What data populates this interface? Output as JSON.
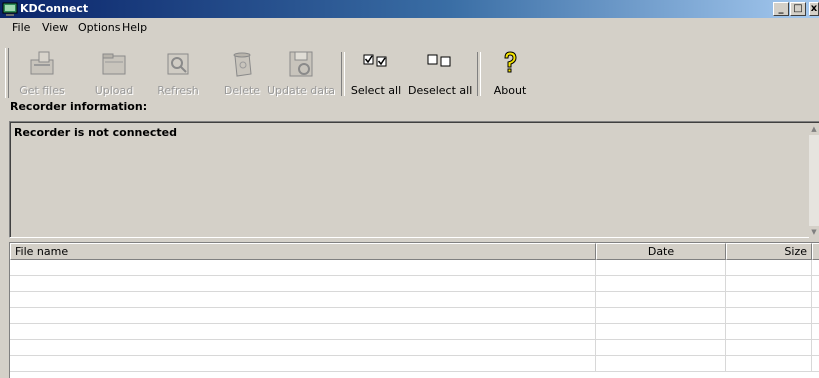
{
  "window": {
    "title": "KDConnect",
    "controls": [
      "_",
      "□",
      "x"
    ]
  },
  "menu": [
    "File",
    "View",
    "Options",
    "Help"
  ],
  "toolbar": [
    {
      "label": "Get files",
      "icon": "get-files-icon",
      "enabled": false
    },
    {
      "label": "Upload",
      "icon": "upload-icon",
      "enabled": false
    },
    {
      "label": "Refresh",
      "icon": "refresh-icon",
      "enabled": false
    },
    {
      "label": "Delete",
      "icon": "delete-icon",
      "enabled": false
    },
    {
      "label": "Update data",
      "icon": "update-data-icon",
      "enabled": false
    },
    {
      "label": "Select all",
      "icon": "select-all-icon",
      "enabled": true
    },
    {
      "label": "Deselect all",
      "icon": "deselect-all-icon",
      "enabled": true
    },
    {
      "label": "About",
      "icon": "about-icon",
      "enabled": true
    }
  ],
  "recorder": {
    "label": "Recorder information:",
    "status": "Recorder is not connected"
  },
  "file_list": {
    "columns": [
      "File name",
      "Date",
      "Size"
    ],
    "rows": []
  },
  "colors": {
    "titlebar_start": "#0a246a",
    "titlebar_end": "#a6caf0",
    "face": "#d4d0c8"
  }
}
